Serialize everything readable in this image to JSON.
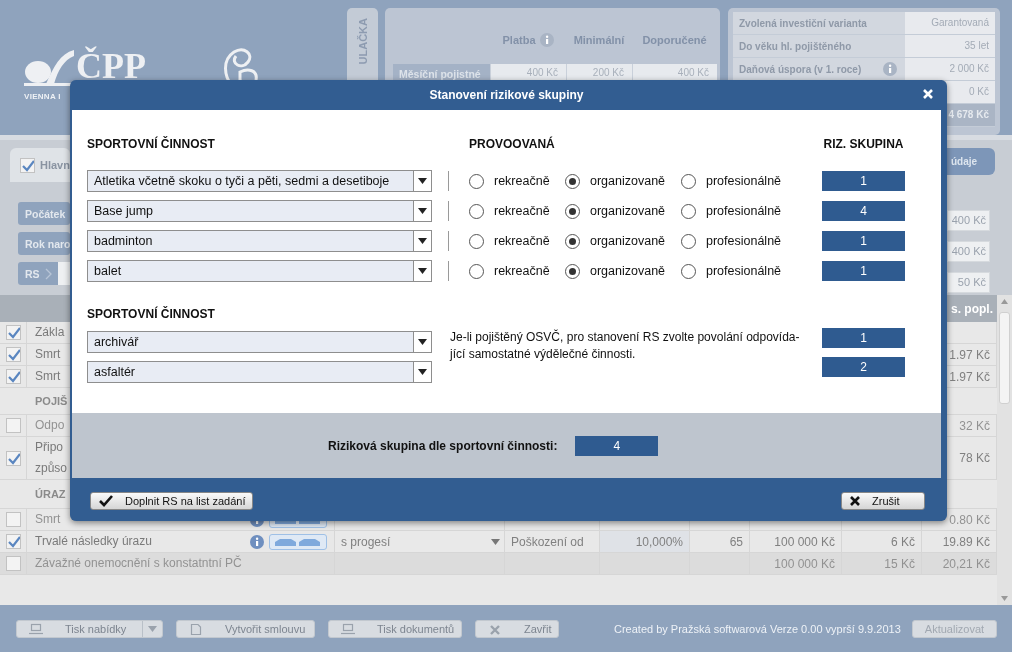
{
  "header": {
    "logo": {
      "name": "ČPP",
      "tagline": "VIENNA I"
    },
    "side_tab": "ULAČKA",
    "payment_panel": {
      "columns": [
        {
          "label": "Platba",
          "info": true
        },
        {
          "label": "Minimální",
          "info": false
        },
        {
          "label": "Doporučené",
          "info": false
        }
      ],
      "row_label": "Měsíční pojistné",
      "values": [
        "400 Kč",
        "200 Kč",
        "400 Kč"
      ]
    },
    "summary": [
      {
        "kind": "row",
        "label": "Zvolená investiční varianta",
        "value": "Garantovaná",
        "info": false
      },
      {
        "kind": "row",
        "label": "Do věku hl. pojištěného",
        "value": "35 let",
        "info": false
      },
      {
        "kind": "row",
        "label": "Daňová úspora (v 1. roce)",
        "value": "2 000 Kč",
        "info": true
      },
      {
        "kind": "row",
        "value": "0 Kč",
        "info": false
      },
      {
        "kind": "total",
        "value": "4 678 Kč",
        "info": false
      }
    ]
  },
  "form": {
    "tab": {
      "label": "Hlavn",
      "checked": true
    },
    "fields": [
      {
        "label": "Počátek",
        "arrow": false
      },
      {
        "label": "Rok naro",
        "arrow": false
      },
      {
        "label": "RS",
        "arrow": true
      }
    ],
    "details_button": "údaje",
    "values": [
      "400 Kč",
      "400 Kč",
      "50 Kč"
    ]
  },
  "table": {
    "column_9": "s. popl.",
    "rows": [
      {
        "kind": "item",
        "name": "Zákla",
        "checked": true,
        "disabled": false,
        "shaded": false,
        "info": false,
        "car": false
      },
      {
        "kind": "item",
        "name": "Smrt",
        "checked": true,
        "disabled": false,
        "shaded": false,
        "info": false,
        "car": false,
        "cells": {
          "column_9": "1.97 Kč"
        }
      },
      {
        "kind": "item",
        "name": "Smrt",
        "checked": true,
        "disabled": false,
        "shaded": false,
        "info": false,
        "car": false,
        "cells": {
          "column_9": "1.97 Kč"
        }
      },
      {
        "kind": "section",
        "name": "POJIŠ"
      },
      {
        "kind": "item",
        "name": "Odpo",
        "checked": false,
        "disabled": true,
        "shaded": false,
        "info": false,
        "car": false,
        "cells": {
          "column_9": "32 Kč"
        }
      },
      {
        "kind": "item",
        "name": "Připo\nzpůso",
        "checked": true,
        "disabled": false,
        "shaded": false,
        "info": false,
        "car": false,
        "cells": {
          "column_9": "78 Kč"
        }
      },
      {
        "kind": "section",
        "name": "ÚRAZ"
      },
      {
        "kind": "item",
        "name": "Smrt",
        "checked": false,
        "disabled": true,
        "shaded": false,
        "info": true,
        "car": true,
        "cells": {
          "column_9": "0.80 Kč"
        }
      },
      {
        "kind": "item",
        "name": "Trvalé následky úrazu",
        "checked": true,
        "disabled": false,
        "shaded": false,
        "info": true,
        "car": true,
        "cells": {
          "column_3": "s progesí",
          "column_4": "Poškození od",
          "column_5": "10,000%",
          "column_6": "65",
          "column_7": "100 000 Kč",
          "column_8": "6 Kč",
          "column_9": "19.89 Kč"
        }
      },
      {
        "kind": "item",
        "name": "Závažné onemocnění s konstatntní PČ",
        "checked": false,
        "disabled": true,
        "shaded": true,
        "info": false,
        "car": false,
        "cells": {
          "column_7": "100 000 Kč",
          "column_8": "15 Kč",
          "column_9": "20,21 Kč"
        }
      }
    ]
  },
  "footer": {
    "buttons": [
      {
        "label": "Tisk nabídky",
        "dropdown": true
      },
      {
        "label": "Vytvořit smlouvu",
        "dropdown": false
      },
      {
        "label": "Tisk dokumentů",
        "dropdown": false
      },
      {
        "label": "Zavřit",
        "dropdown": false
      }
    ],
    "credits": "Created by Pražská softwarová  Verze 0.00 vyprší 9.9.2013",
    "update_button": "Aktualizovat"
  },
  "dialog": {
    "title": "Stanovení rizikové skupiny",
    "sport_heading": "SPORTOVNÍ ČINNOST",
    "mode_heading": "PROVOOVANÁ",
    "group_heading": "RIZ. SKUPINA",
    "sports": [
      {
        "activity": "Atletika včetně skoku o tyči a pěti, sedmi a desetiboje",
        "options": [
          {
            "label": "rekreačně",
            "selected": false
          },
          {
            "label": "organizovaně",
            "selected": true
          },
          {
            "label": "profesionálně",
            "selected": false
          }
        ],
        "group": "1"
      },
      {
        "activity": "Base jump",
        "options": [
          {
            "label": "rekreačně",
            "selected": false
          },
          {
            "label": "organizovaně",
            "selected": true
          },
          {
            "label": "profesionálně",
            "selected": false
          }
        ],
        "group": "4"
      },
      {
        "activity": "badminton",
        "options": [
          {
            "label": "rekreačně",
            "selected": false
          },
          {
            "label": "organizovaně",
            "selected": true
          },
          {
            "label": "profesionálně",
            "selected": false
          }
        ],
        "group": "1"
      },
      {
        "activity": "balet",
        "options": [
          {
            "label": "rekreačně",
            "selected": false
          },
          {
            "label": "organizovaně",
            "selected": true
          },
          {
            "label": "profesionálně",
            "selected": false
          }
        ],
        "group": "1"
      }
    ],
    "occupation_heading": "SPORTOVNÍ ČINNOST",
    "occupations": [
      {
        "activity": "archivář",
        "group": "1"
      },
      {
        "activity": "asfaltér",
        "group": "2"
      }
    ],
    "occupation_note": "Je-li pojištěný OSVČ, pro stanovení RS zvolte povolání odpovída-jící samostatné výdělečné činnosti.",
    "result_label": "Riziková skupina dle sportovní činnosti:",
    "result_value": "4",
    "confirm_button": "Doplnit RS na list zadání",
    "cancel_button": "Zrušit"
  }
}
